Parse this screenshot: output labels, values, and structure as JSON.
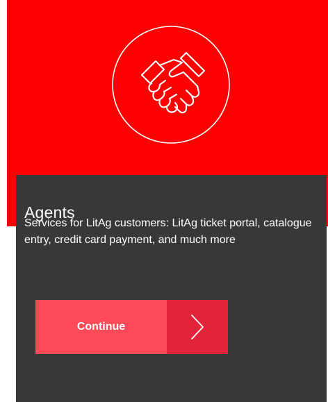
{
  "colors": {
    "hero_background": "#ff0000",
    "card_background": "#383838",
    "button_primary": "#fe4a56",
    "button_arrow": "#e2233a",
    "text": "#ffffff"
  },
  "hero": {
    "icon": "handshake-icon"
  },
  "card": {
    "title": "Agents",
    "description": "Services for LitAg customers: LitAg ticket portal, catalogue entry, credit card payment, and much more",
    "button": {
      "label": "Continue",
      "icon": "chevron-right-icon"
    }
  }
}
